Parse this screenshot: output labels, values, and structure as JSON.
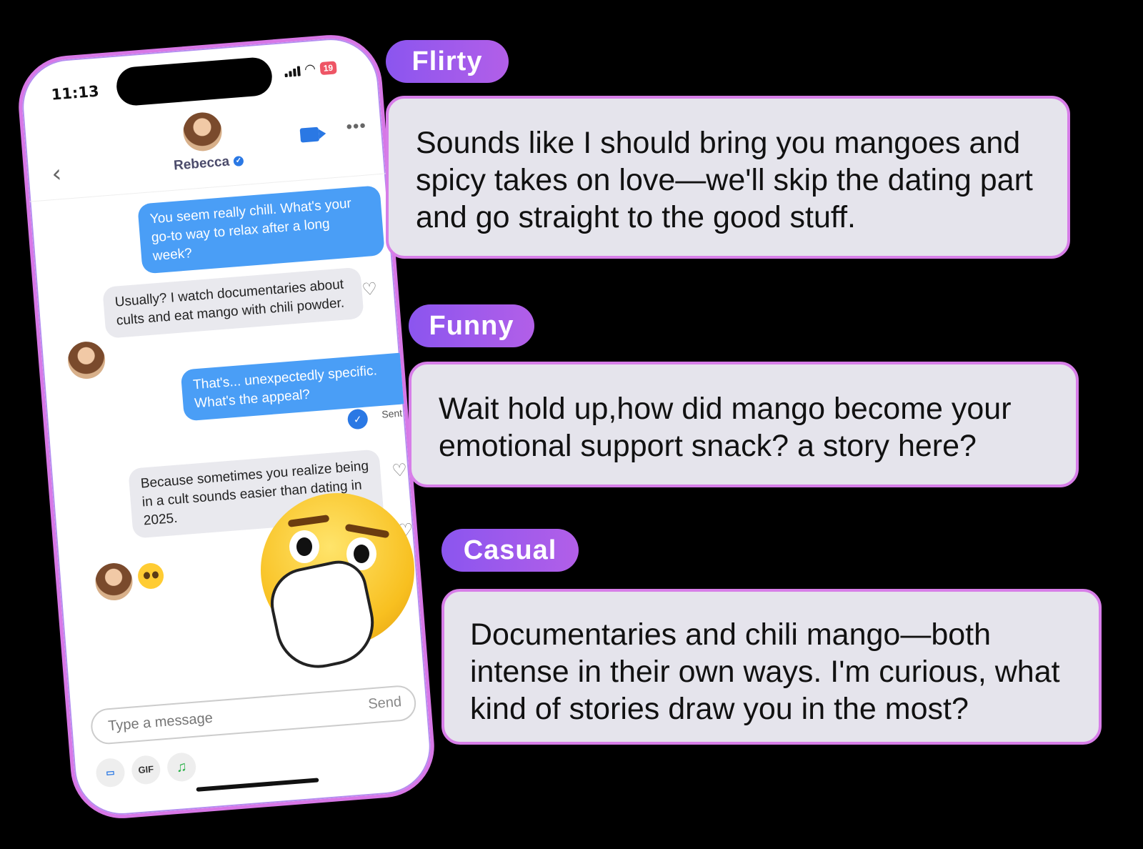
{
  "phone": {
    "status": {
      "time": "11:13",
      "battery": "19"
    },
    "contact": {
      "name": "Rebecca"
    },
    "messages": [
      {
        "side": "out",
        "text": "You seem really chill. What's your go-to way to relax after a long week?"
      },
      {
        "side": "in",
        "text": "Usually? I watch documentaries about cults and eat mango with chili powder."
      },
      {
        "side": "out",
        "text": "That's... unexpectedly specific. What's the appeal?"
      },
      {
        "side": "in",
        "text": "Because sometimes you realize being in a cult sounds easier than dating in 2025."
      }
    ],
    "sent_label": "Sent",
    "composer": {
      "placeholder": "Type a message",
      "send_label": "Send"
    },
    "tools": {
      "gif_label": "GIF"
    }
  },
  "suggestions": [
    {
      "tag": "Flirty",
      "text": "Sounds like I should bring you mangoes and spicy takes on love—we'll skip the dating part and go straight to the good stuff."
    },
    {
      "tag": "Funny",
      "text": "Wait hold up,how did mango become your emotional support snack? a story here?"
    },
    {
      "tag": "Casual",
      "text": "Documentaries and chili mango—both intense in their own ways. I'm curious, what kind of stories draw you in the most?"
    }
  ],
  "colors": {
    "tag_gradient_start": "#8b55ef",
    "tag_gradient_end": "#b25fe8",
    "card_border": "#d77ee8",
    "outgoing_bubble": "#4a9ef6"
  }
}
